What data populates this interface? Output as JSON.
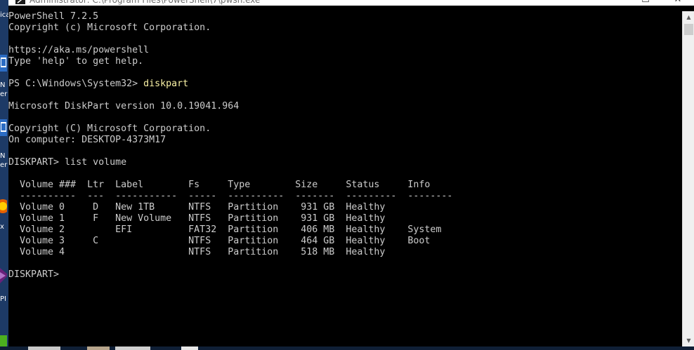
{
  "window": {
    "title": "Administrator: C:\\Program Files\\PowerShell\\7\\pwsh.exe",
    "minimize_glyph": "—",
    "maximize_glyph": "☐",
    "close_glyph": "✕"
  },
  "desktop_labels": [
    "ica",
    "N",
    "er",
    "N",
    "er",
    "x",
    "PI"
  ],
  "console": {
    "lines": [
      "PowerShell 7.2.5",
      "Copyright (c) Microsoft Corporation.",
      "",
      "https://aka.ms/powershell",
      "Type 'help' to get help.",
      "",
      "PS C:\\Windows\\System32> ",
      "",
      "Microsoft DiskPart version 10.0.19041.964",
      "",
      "Copyright (C) Microsoft Corporation.",
      "On computer: DESKTOP-4373M17",
      "",
      "DISKPART> list volume",
      "",
      "  Volume ###  Ltr  Label        Fs     Type        Size     Status     Info",
      "  ----------  ---  -----------  -----  ----------  -------  ---------  --------",
      "  Volume 0     D   New 1TB      NTFS   Partition    931 GB  Healthy",
      "  Volume 1     F   New Volume   NTFS   Partition    931 GB  Healthy",
      "  Volume 2         EFI          FAT32  Partition    406 MB  Healthy    System",
      "  Volume 3     C                NTFS   Partition    464 GB  Healthy    Boot",
      "  Volume 4                      NTFS   Partition    518 MB  Healthy",
      "",
      "DISKPART> "
    ],
    "typed_command": "diskpart",
    "text_color": "#cccccc",
    "command_color": "#f9f1a5",
    "background": "#000000"
  },
  "scrollbar": {
    "up_arrow": "▲",
    "down_arrow": "▼"
  }
}
